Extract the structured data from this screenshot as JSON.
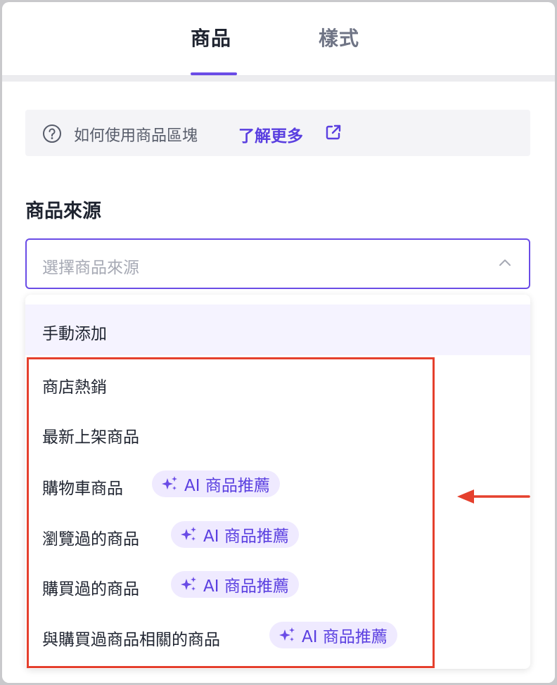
{
  "tabs": {
    "products": "商品",
    "style": "樣式"
  },
  "help": {
    "text": "如何使用商品區塊",
    "link": "了解更多",
    "help_icon": "question-circle-icon",
    "link_icon": "external-link-icon"
  },
  "source": {
    "label": "商品來源",
    "placeholder": "選擇商品來源",
    "chevron_icon": "chevron-up-icon"
  },
  "options": [
    {
      "label": "手動添加",
      "badge": ""
    },
    {
      "label": "商店熱銷",
      "badge": ""
    },
    {
      "label": "最新上架商品",
      "badge": ""
    },
    {
      "label": "購物車商品",
      "badge": "AI 商品推薦"
    },
    {
      "label": "瀏覽過的商品",
      "badge": "AI 商品推薦"
    },
    {
      "label": "購買過的商品",
      "badge": "AI 商品推薦"
    },
    {
      "label": "與購買過商品相關的商品",
      "badge": "AI 商品推薦"
    }
  ],
  "colors": {
    "accent": "#6a4ce6",
    "link": "#5a3fe0",
    "badge_bg": "#efeaff",
    "highlight": "#e5402d",
    "option_hover": "#f5f3ff"
  }
}
